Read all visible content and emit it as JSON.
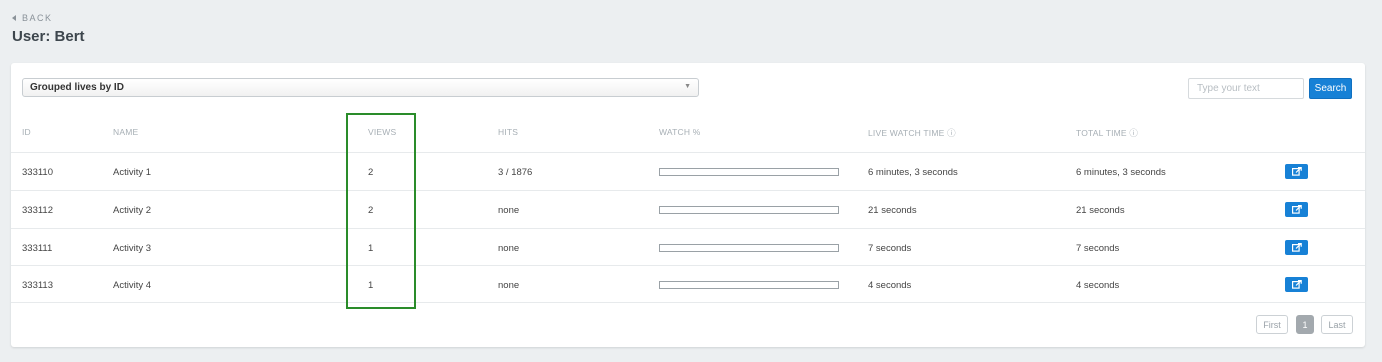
{
  "nav": {
    "back_label": "BACK"
  },
  "page": {
    "title": "User: Bert"
  },
  "toolbar": {
    "group_select_value": "Grouped lives by ID",
    "search_placeholder": "Type your text",
    "search_button": "Search"
  },
  "table": {
    "headers": {
      "id": "ID",
      "name": "NAME",
      "views": "VIEWS",
      "hits": "HITS",
      "watch": "WATCH %",
      "live_watch_time": "LIVE WATCH TIME ⓘ",
      "total_time": "TOTAL TIME ⓘ"
    },
    "rows": [
      {
        "id": "333110",
        "name": "Activity 1",
        "views": "2",
        "hits": "3 / 1876",
        "watch_pct": 0,
        "live_watch_time": "6 minutes, 3 seconds",
        "total_time": "6 minutes, 3 seconds"
      },
      {
        "id": "333112",
        "name": "Activity 2",
        "views": "2",
        "hits": "none",
        "watch_pct": 0,
        "live_watch_time": "21 seconds",
        "total_time": "21 seconds"
      },
      {
        "id": "333111",
        "name": "Activity 3",
        "views": "1",
        "hits": "none",
        "watch_pct": 0,
        "live_watch_time": "7 seconds",
        "total_time": "7 seconds"
      },
      {
        "id": "333113",
        "name": "Activity 4",
        "views": "1",
        "hits": "none",
        "watch_pct": 0,
        "live_watch_time": "4 seconds",
        "total_time": "4 seconds"
      }
    ]
  },
  "pagination": {
    "first": "First",
    "current": "1",
    "last": "Last"
  },
  "colors": {
    "accent": "#1781d6",
    "highlight": "#2a8c2a"
  }
}
